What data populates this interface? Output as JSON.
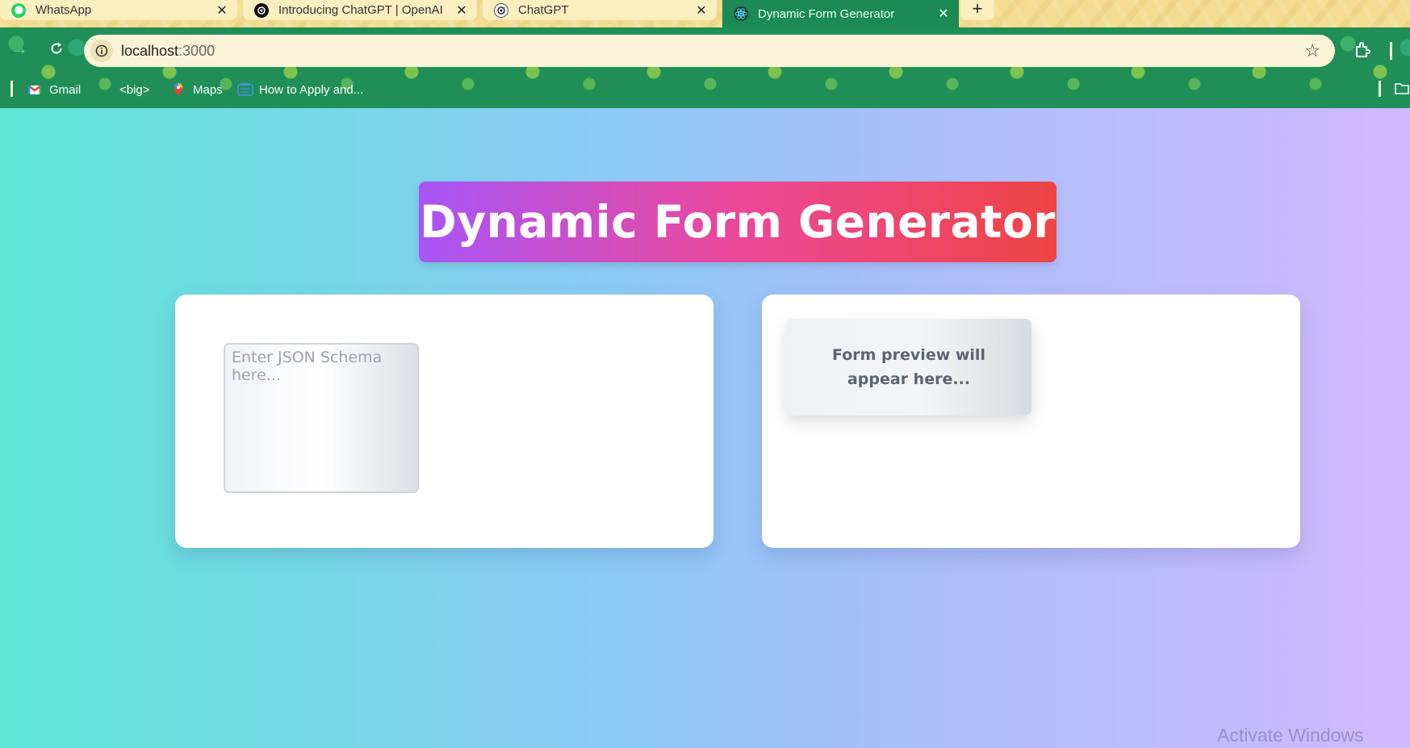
{
  "tabs": [
    {
      "title": "WhatsApp",
      "icon": "whatsapp-icon",
      "active": false
    },
    {
      "title": "Introducing ChatGPT | OpenAI",
      "icon": "openai-icon",
      "active": false
    },
    {
      "title": "ChatGPT",
      "icon": "openai-icon",
      "active": false
    },
    {
      "title": "Dynamic Form Generator",
      "icon": "react-icon",
      "active": true
    }
  ],
  "tab_close_glyph": "✕",
  "new_tab_glyph": "+",
  "address": {
    "host": "localhost",
    "port": ":3000"
  },
  "bookmarks": [
    {
      "label": "Gmail",
      "icon": "gmail-icon"
    },
    {
      "label": "<big>",
      "icon": "bookmark-folder-icon"
    },
    {
      "label": "Maps",
      "icon": "maps-icon"
    },
    {
      "label": "How to Apply and...",
      "icon": "page-icon"
    }
  ],
  "page": {
    "title": "Dynamic Form Generator",
    "schema_placeholder": "Enter JSON Schema here...",
    "preview_text": "Form preview will appear here..."
  },
  "watermark": "Activate Windows",
  "colors": {
    "title_gradient": [
      "#a855f7",
      "#ec4899",
      "#ef4444"
    ],
    "page_gradient": [
      "#5fe6d6",
      "#8ec9f7",
      "#d1b9fd"
    ],
    "toolbar": "#1f8f57",
    "tab_strip": "#f3dc92"
  }
}
